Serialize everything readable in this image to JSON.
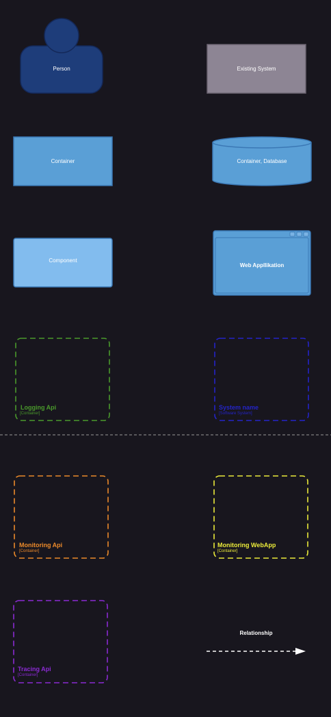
{
  "shapes": {
    "person": {
      "label": "Person"
    },
    "existing_system": {
      "label": "Existing System"
    },
    "container": {
      "label": "Container"
    },
    "database": {
      "label": "Container, Database"
    },
    "component": {
      "label": "Component"
    },
    "web_app": {
      "label": "Web Appllikation"
    }
  },
  "boundaries": {
    "logging_api": {
      "title": "Logging Api",
      "type": "[Container]",
      "color": "#4a9a2c"
    },
    "system_name": {
      "title": "System name",
      "type": "[Software System]",
      "color": "#2424c8"
    },
    "monitoring_api": {
      "title": "Monitoring Api",
      "type": "[Container]",
      "color": "#ec8a2a"
    },
    "monitoring_webapp": {
      "title": "Monitoring WebApp",
      "type": "[Container]",
      "color": "#ecec3a"
    },
    "tracing_api": {
      "title": "Tracing Api",
      "type": "[Container]",
      "color": "#8a2ad2"
    }
  },
  "relationship": {
    "label": "Relationship"
  },
  "colors": {
    "background": "#18161e",
    "person_fill": "#1e3d7a",
    "existing_system_fill": "#8d8594",
    "container_fill": "#5a9fd6",
    "component_fill": "#82bcee",
    "separator": "#9a9a9a"
  }
}
